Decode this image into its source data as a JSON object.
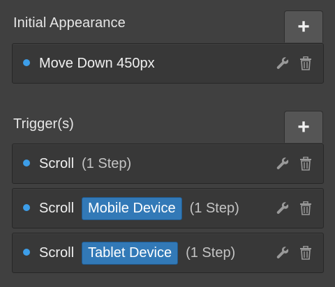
{
  "initial_appearance": {
    "title": "Initial Appearance",
    "add_label": "+",
    "items": [
      {
        "name": "Move Down 450px",
        "device": "",
        "steps": ""
      }
    ]
  },
  "triggers": {
    "title": "Trigger(s)",
    "add_label": "+",
    "items": [
      {
        "name": "Scroll",
        "device": "",
        "steps": "(1 Step)"
      },
      {
        "name": "Scroll",
        "device": "Mobile Device",
        "steps": "(1 Step)"
      },
      {
        "name": "Scroll",
        "device": "Tablet Device",
        "steps": "(1 Step)"
      }
    ]
  },
  "icons": {
    "bullet": "status-dot",
    "edit": "wrench-icon",
    "delete": "trash-icon"
  },
  "colors": {
    "background": "#404040",
    "row": "#383838",
    "accent": "#3d9ee9",
    "badge": "#3279b7"
  }
}
